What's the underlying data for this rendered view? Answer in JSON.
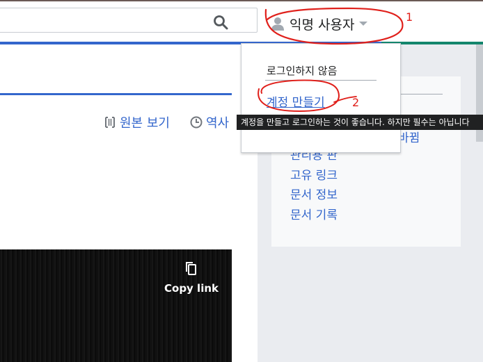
{
  "header": {
    "user_menu_label": "익명 사용자"
  },
  "tabs": {
    "view_source": "원본 보기",
    "history": "역사"
  },
  "dropdown": {
    "status": "로그인하지 않음",
    "create_account": "계정 만들기"
  },
  "tooltip": "계정을 만들고 로그인하는 것이 좋습니다. 하지만 필수는 아닙니다",
  "sidebar": {
    "links": [
      {
        "label": "바뀜"
      },
      {
        "label": "관리용 판"
      },
      {
        "label": "고유 링크"
      },
      {
        "label": "문서 정보"
      },
      {
        "label": "문서 기록"
      }
    ]
  },
  "video": {
    "copy_link_label": "Copy link"
  },
  "annotations": {
    "mark_1": "1",
    "mark_2": "2"
  },
  "colors": {
    "link": "#3366cc",
    "annotation": "#e0201b",
    "tooltip_bg": "#202122",
    "sidebar_bg": "#eaecf0"
  }
}
